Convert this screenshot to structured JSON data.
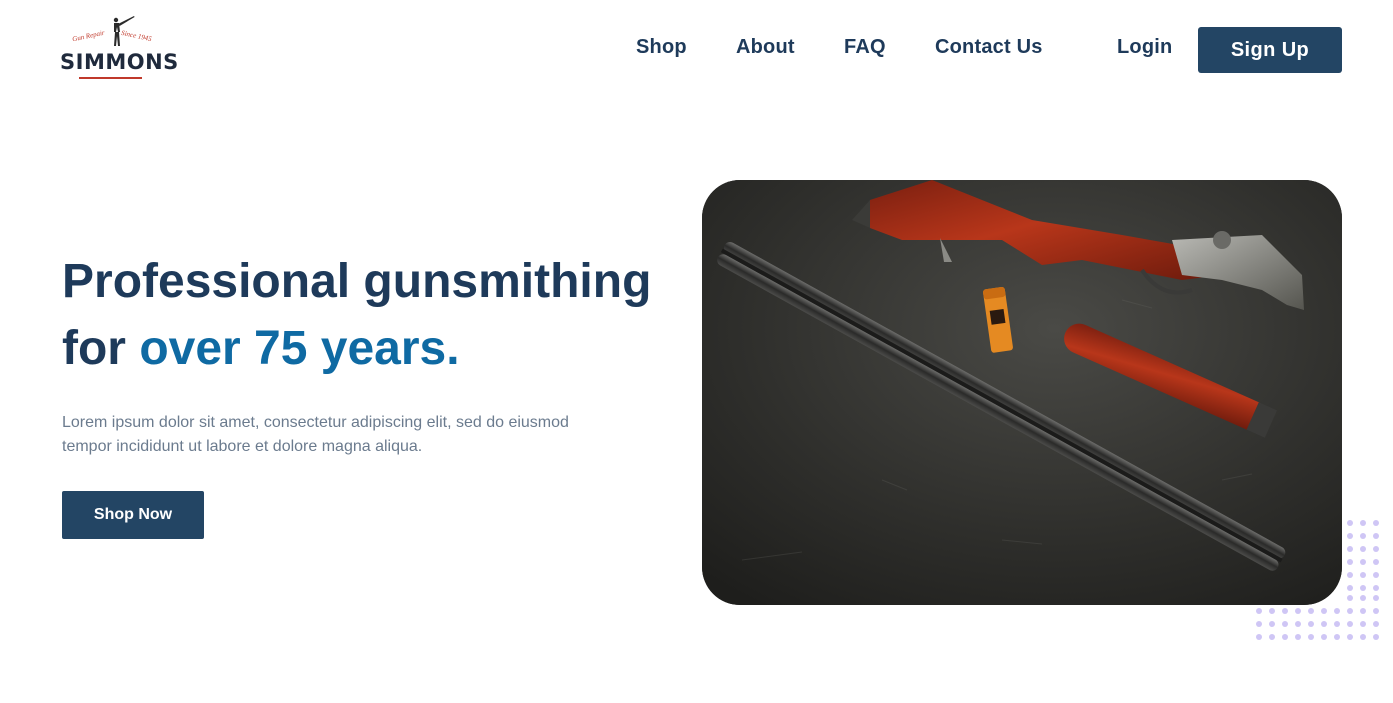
{
  "brand": {
    "name": "SIMMONS",
    "tagline_left": "Gun Repair",
    "tagline_right": "Since 1945"
  },
  "nav": {
    "items": [
      "Shop",
      "About",
      "FAQ",
      "Contact Us"
    ],
    "login": "Login",
    "signup": "Sign Up"
  },
  "hero": {
    "title_line1": "Professional gunsmithing",
    "title_line2_prefix": "for ",
    "title_line2_accent": "over 75 years.",
    "description": "Lorem ipsum dolor sit amet, consectetur adipiscing elit, sed do eiusmod tempor incididunt ut labore et dolore magna aliqua.",
    "cta": "Shop Now"
  },
  "colors": {
    "primary": "#234564",
    "heading": "#1e3a5a",
    "accent": "#0f6aa3",
    "body_text": "#6b7b8e",
    "dots": "#cfc6f5"
  }
}
